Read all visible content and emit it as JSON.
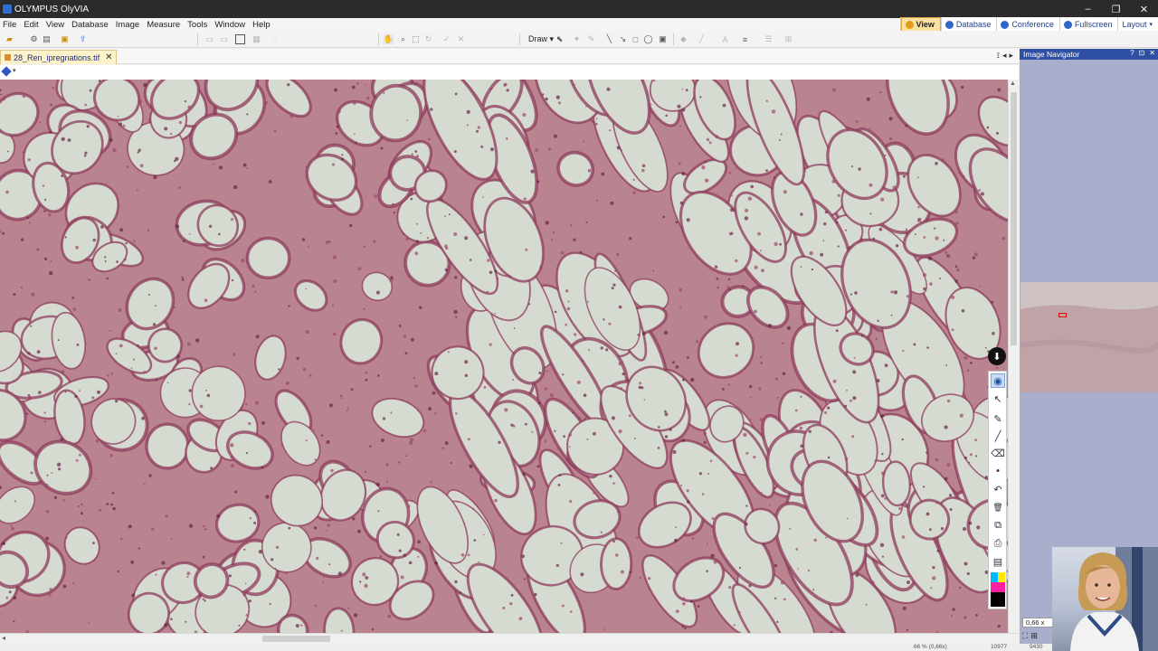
{
  "window": {
    "title": "OLYMPUS OlyVIA",
    "controls": [
      "–",
      "❐",
      "✕"
    ]
  },
  "menu": [
    "File",
    "Edit",
    "View",
    "Database",
    "Image",
    "Measure",
    "Tools",
    "Window",
    "Help"
  ],
  "modes": [
    {
      "label": "View",
      "active": true,
      "color": "#e09a1c"
    },
    {
      "label": "Database",
      "active": false,
      "color": "#2e66c9"
    },
    {
      "label": "Conference",
      "active": false,
      "color": "#2e66c9"
    },
    {
      "label": "Fullscreen",
      "active": false,
      "color": "#2e66c9"
    },
    {
      "label": "Layout",
      "active": false,
      "color": "#555555"
    }
  ],
  "toolbar": {
    "draw_label": "Draw ▾"
  },
  "document": {
    "tab_label": "28_Ren_ipregnations.tif",
    "close_glyph": "✕",
    "nav_glyphs": [
      "⟟",
      "◂",
      "▸"
    ]
  },
  "layer_bar": {
    "dropdown_glyph": "▾"
  },
  "side_tools": {
    "top_glyph": "⬇",
    "items": [
      "eye-icon",
      "pointer-icon",
      "pen-icon",
      "line-icon",
      "eraser-icon",
      "dot-icon",
      "undo-icon",
      "delete-icon",
      "copy-icon",
      "snapshot-icon",
      "clipboard-icon"
    ],
    "glyphs": [
      "◉",
      "↖",
      "✎",
      "╱",
      "⌫",
      "•",
      "↶",
      "🗑",
      "⧉",
      "⎙",
      "▤"
    ],
    "swatches": [
      "#00b7ff",
      "#ffe800",
      "#ff1fa0",
      "#000000"
    ]
  },
  "navigator": {
    "title": "Image Navigator",
    "controls": [
      "?",
      "⊡",
      "✕"
    ],
    "zoom_readout": "0,66 x",
    "nav_icons": [
      "⛶",
      "⊞"
    ]
  },
  "status": {
    "zoom": "66 % (0,66x)",
    "x": "10977",
    "y": "9430"
  },
  "colors": {
    "accent": "#2f4fa3",
    "active_tab": "#fbe2a2",
    "tissue_stain": "#8e3a5a",
    "lumen": "#d5dbd1"
  }
}
